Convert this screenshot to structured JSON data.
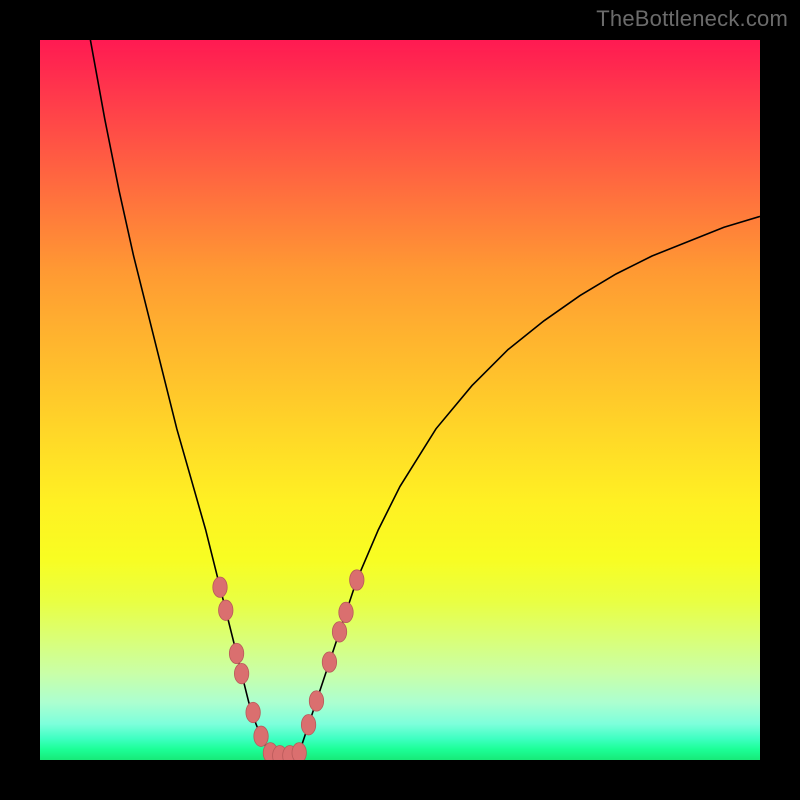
{
  "watermark": "TheBottleneck.com",
  "chart_data": {
    "type": "line",
    "title": "",
    "xlabel": "",
    "ylabel": "",
    "xlim": [
      0,
      100
    ],
    "ylim": [
      0,
      100
    ],
    "grid": false,
    "series": [
      {
        "name": "left-curve",
        "x": [
          7,
          9,
          11,
          13,
          15,
          17,
          19,
          21,
          23,
          25,
          26,
          27,
          28,
          29,
          30,
          31,
          32
        ],
        "y": [
          100,
          89,
          79,
          70,
          62,
          54,
          46,
          39,
          32,
          24,
          20,
          16,
          12,
          8,
          5,
          2.5,
          1
        ]
      },
      {
        "name": "floor",
        "x": [
          32,
          33,
          34,
          35,
          36
        ],
        "y": [
          1,
          0.6,
          0.5,
          0.6,
          1
        ]
      },
      {
        "name": "right-curve",
        "x": [
          36,
          38,
          40,
          42,
          44,
          47,
          50,
          55,
          60,
          65,
          70,
          75,
          80,
          85,
          90,
          95,
          100
        ],
        "y": [
          1,
          7,
          13,
          19,
          25,
          32,
          38,
          46,
          52,
          57,
          61,
          64.5,
          67.5,
          70,
          72,
          74,
          75.5
        ]
      }
    ],
    "beads": {
      "name": "highlighted-range",
      "color": "#da6f6f",
      "points": [
        {
          "x": 25.0,
          "y": 24.0
        },
        {
          "x": 25.8,
          "y": 20.8
        },
        {
          "x": 27.3,
          "y": 14.8
        },
        {
          "x": 28.0,
          "y": 12.0
        },
        {
          "x": 29.6,
          "y": 6.6
        },
        {
          "x": 30.7,
          "y": 3.3
        },
        {
          "x": 32.0,
          "y": 1.0
        },
        {
          "x": 33.3,
          "y": 0.6
        },
        {
          "x": 34.7,
          "y": 0.6
        },
        {
          "x": 36.0,
          "y": 1.0
        },
        {
          "x": 37.3,
          "y": 4.9
        },
        {
          "x": 38.4,
          "y": 8.2
        },
        {
          "x": 40.2,
          "y": 13.6
        },
        {
          "x": 41.6,
          "y": 17.8
        },
        {
          "x": 42.5,
          "y": 20.5
        },
        {
          "x": 44.0,
          "y": 25.0
        }
      ]
    }
  }
}
